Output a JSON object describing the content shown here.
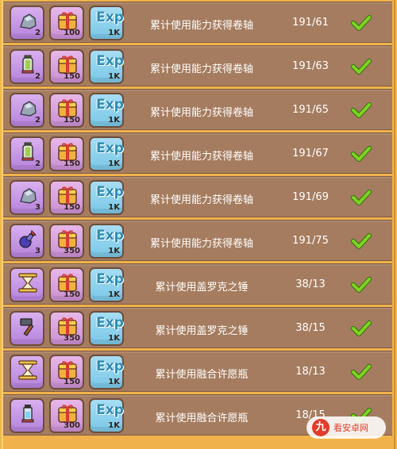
{
  "rows": [
    {
      "item_icon": "rock-icon",
      "item_qty": "2",
      "gift_qty": "100",
      "exp_label": "Exp",
      "exp_qty": "1K",
      "task": "累计使用能力获得卷轴",
      "progress": "191/61",
      "status_icon": "check-icon"
    },
    {
      "item_icon": "lantern-icon",
      "item_qty": "2",
      "gift_qty": "150",
      "exp_label": "Exp",
      "exp_qty": "1K",
      "task": "累计使用能力获得卷轴",
      "progress": "191/63",
      "status_icon": "check-icon"
    },
    {
      "item_icon": "rock-icon",
      "item_qty": "2",
      "gift_qty": "150",
      "exp_label": "Exp",
      "exp_qty": "1K",
      "task": "累计使用能力获得卷轴",
      "progress": "191/65",
      "status_icon": "check-icon"
    },
    {
      "item_icon": "lantern-icon",
      "item_qty": "2",
      "gift_qty": "150",
      "exp_label": "Exp",
      "exp_qty": "1K",
      "task": "累计使用能力获得卷轴",
      "progress": "191/67",
      "status_icon": "check-icon"
    },
    {
      "item_icon": "rock-icon",
      "item_qty": "3",
      "gift_qty": "150",
      "exp_label": "Exp",
      "exp_qty": "1K",
      "task": "累计使用能力获得卷轴",
      "progress": "191/69",
      "status_icon": "check-icon"
    },
    {
      "item_icon": "potion-icon",
      "item_qty": "3",
      "gift_qty": "350",
      "exp_label": "Exp",
      "exp_qty": "1K",
      "task": "累计使用能力获得卷轴",
      "progress": "191/75",
      "status_icon": "check-icon"
    },
    {
      "item_icon": "hourglass-icon",
      "item_qty": "",
      "gift_qty": "150",
      "exp_label": "Exp",
      "exp_qty": "1K",
      "task": "累计使用盖罗克之锤",
      "progress": "38/13",
      "status_icon": "check-icon"
    },
    {
      "item_icon": "hammer-icon",
      "item_qty": "",
      "gift_qty": "350",
      "exp_label": "Exp",
      "exp_qty": "1K",
      "task": "累计使用盖罗克之锤",
      "progress": "38/15",
      "status_icon": "check-icon"
    },
    {
      "item_icon": "hourglass-icon",
      "item_qty": "",
      "gift_qty": "150",
      "exp_label": "Exp",
      "exp_qty": "1K",
      "task": "累计使用融合许愿瓶",
      "progress": "18/13",
      "status_icon": "check-icon"
    },
    {
      "item_icon": "bottle-icon",
      "item_qty": "",
      "gift_qty": "300",
      "exp_label": "Exp",
      "exp_qty": "1K",
      "task": "累计使用融合许愿瓶",
      "progress": "18/15",
      "status_icon": "check-icon"
    }
  ],
  "watermark": {
    "logo_char": "九",
    "text": "看安卓网"
  },
  "colors": {
    "row_bg": "#a57c5f",
    "frame": "#f0b24a",
    "check": "#7ed321",
    "exp_blue": "#2d8cb5"
  }
}
